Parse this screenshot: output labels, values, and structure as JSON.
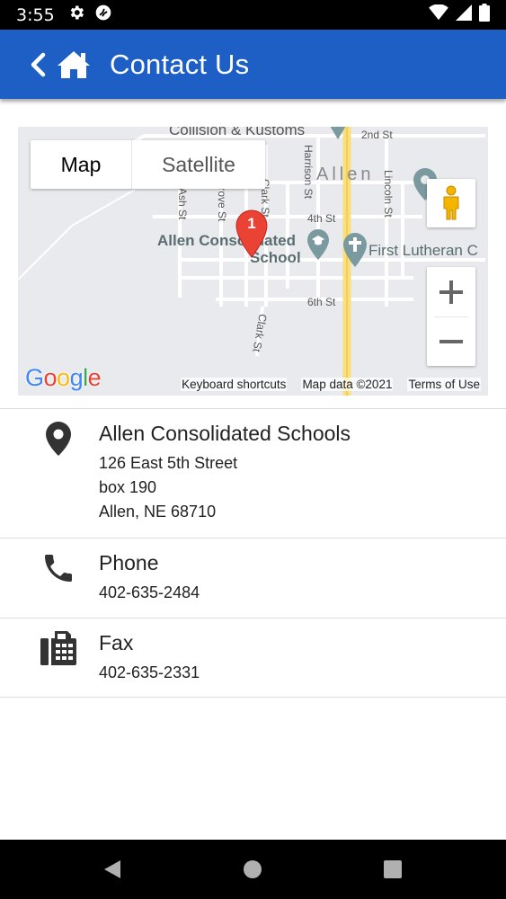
{
  "status_bar": {
    "time": "3:55",
    "left_icons": [
      "gear-icon",
      "sync-icon"
    ],
    "right_icons": [
      "wifi-icon",
      "signal-icon",
      "battery-icon"
    ]
  },
  "app_bar": {
    "title": "Contact Us",
    "color": "#1e5fc6",
    "back_icon": "chevron-left-icon",
    "home_icon": "home-icon"
  },
  "map": {
    "type_options": {
      "map": "Map",
      "satellite": "Satellite"
    },
    "selected_type": "Map",
    "labels": {
      "top_business": "Collision & Kustoms",
      "street_2nd": "2nd St",
      "street_harrison": "Harrison St",
      "town": "Allen",
      "street_lincoln": "Lincoln St",
      "street_ash": "Ash St",
      "street_grove": "Grove St",
      "street_clark_top": "Clark St",
      "street_4th": "4th St",
      "street_6th": "6th St",
      "street_clark_bottom": "Clark St",
      "school_line1": "Allen Consolidated",
      "school_line2": "School",
      "church": "First Lutheran C",
      "marker_number": "1"
    },
    "google": "Google",
    "footer_links": [
      "Keyboard shortcuts",
      "Map data ©2021",
      "Terms of Use"
    ],
    "zoom_in": "+",
    "zoom_out": "−"
  },
  "contacts": [
    {
      "icon": "location-pin-icon",
      "title": "Allen Consolidated Schools",
      "lines": [
        "126 East 5th Street",
        "box 190",
        "Allen, NE  68710"
      ]
    },
    {
      "icon": "phone-icon",
      "title": "Phone",
      "lines": [
        "402-635-2484"
      ]
    },
    {
      "icon": "fax-icon",
      "title": "Fax",
      "lines": [
        "402-635-2331"
      ]
    }
  ],
  "nav_bar": {
    "icons": [
      "back-triangle-icon",
      "home-circle-icon",
      "recents-square-icon"
    ]
  }
}
